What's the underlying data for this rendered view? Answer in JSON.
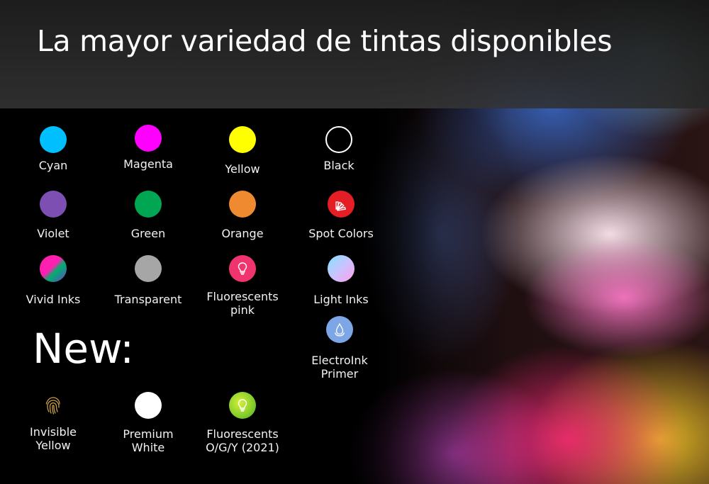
{
  "title": "La mayor variedad de tintas disponibles",
  "new_heading": "New:",
  "inks": {
    "cyan": {
      "label": "Cyan",
      "color": "#00BFFF"
    },
    "magenta": {
      "label": "Magenta",
      "color": "#FF00FF"
    },
    "yellow": {
      "label": "Yellow",
      "color": "#FFFF00"
    },
    "black": {
      "label": "Black",
      "color": "#000000"
    },
    "violet": {
      "label": "Violet",
      "color": "#7E4FB3"
    },
    "green": {
      "label": "Green",
      "color": "#00A651"
    },
    "orange": {
      "label": "Orange",
      "color": "#F08A30"
    },
    "spot": {
      "label": "Spot Colors",
      "color": "#E31E24"
    },
    "vivid": {
      "label": "Vivid Inks"
    },
    "transparent": {
      "label": "Transparent",
      "color": "#A6A6A6"
    },
    "fluor_pink": {
      "label_line1": "Fluorescents",
      "label_line2": "pink",
      "color": "#F0346E"
    },
    "light": {
      "label": "Light Inks"
    },
    "electroink": {
      "label_line1": "ElectroInk",
      "label_line2": "Primer",
      "color": "#7DA6E6"
    },
    "invisible_yellow": {
      "label_line1": "Invisible",
      "label_line2": "Yellow",
      "color": "#C8A043"
    },
    "premium_white": {
      "label_line1": "Premium",
      "label_line2": "White",
      "color": "#FFFFFF"
    },
    "fluor_ogy": {
      "label_line1": "Fluorescents",
      "label_line2": "O/G/Y (2021)",
      "color": "#8BCF2C"
    }
  }
}
